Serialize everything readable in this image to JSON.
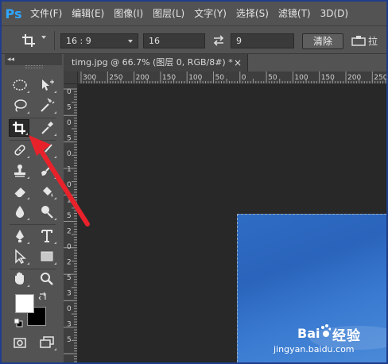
{
  "app": {
    "logo": "Ps"
  },
  "menu": {
    "items": [
      "文件(F)",
      "编辑(E)",
      "图像(I)",
      "图层(L)",
      "文字(Y)",
      "选择(S)",
      "滤镜(T)",
      "3D(D)"
    ]
  },
  "options": {
    "ratio": "16 : 9",
    "width": "16",
    "height": "9",
    "clear_label": "清除",
    "straighten_label": "拉"
  },
  "toolbar": {
    "collapse": "◂◂",
    "close": "×"
  },
  "document": {
    "tab_title": "timg.jpg @ 66.7% (图层 0, RGB/8#) *",
    "close": "×"
  },
  "rulers": {
    "horizontal": [
      "300",
      "250",
      "200",
      "150",
      "100",
      "50",
      "0",
      "50",
      "100",
      "150",
      "200",
      "250",
      "300"
    ],
    "vertical": [
      "0",
      "5",
      "0",
      "5",
      "0",
      "1",
      "0",
      "1",
      "5",
      "2",
      "0",
      "2",
      "5",
      "3",
      "0",
      "3",
      "5"
    ]
  },
  "watermark": {
    "brand": "经验",
    "url": "jingyan.baidu.com"
  },
  "colors": {
    "accent": "#2fa6ff",
    "arrow": "#e8222b",
    "canvas": "#282828",
    "photo": "#2f6cc4"
  }
}
